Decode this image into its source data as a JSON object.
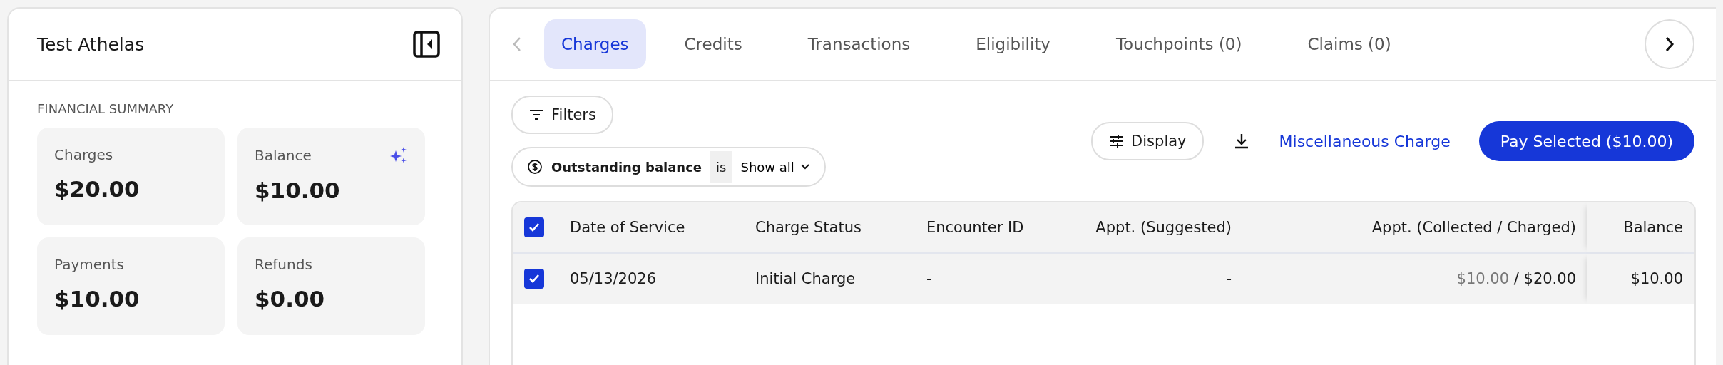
{
  "sidebar": {
    "title": "Test Athelas",
    "section_label": "FINANCIAL SUMMARY",
    "cards": [
      {
        "label": "Charges",
        "value": "$20.00",
        "sparkle": false
      },
      {
        "label": "Balance",
        "value": "$10.00",
        "sparkle": true
      },
      {
        "label": "Payments",
        "value": "$10.00",
        "sparkle": false
      },
      {
        "label": "Refunds",
        "value": "$0.00",
        "sparkle": false
      }
    ]
  },
  "tabs": [
    {
      "label": "Charges",
      "selected": true
    },
    {
      "label": "Credits",
      "selected": false
    },
    {
      "label": "Transactions",
      "selected": false
    },
    {
      "label": "Eligibility",
      "selected": false
    },
    {
      "label": "Touchpoints (0)",
      "selected": false
    },
    {
      "label": "Claims (0)",
      "selected": false
    }
  ],
  "toolbar": {
    "filters_label": "Filters",
    "filter_chip": {
      "field": "Outstanding balance",
      "operator": "is",
      "value": "Show all"
    },
    "display_label": "Display",
    "link_label": "Miscellaneous Charge",
    "primary_label": "Pay Selected ($10.00)"
  },
  "table": {
    "all_checked": true,
    "columns": [
      {
        "label": "Date of Service"
      },
      {
        "label": "Charge Status"
      },
      {
        "label": "Encounter ID"
      },
      {
        "label": "Appt. (Suggested)"
      },
      {
        "label": "Appt. (Collected / Charged)"
      },
      {
        "label": "Balance"
      }
    ],
    "rows": [
      {
        "selected": true,
        "date": "05/13/2026",
        "status": "Initial Charge",
        "encounter": "-",
        "suggested": "-",
        "collected": "$10.00",
        "separator": "/",
        "charged": "$20.00",
        "balance": "$10.00"
      }
    ]
  }
}
